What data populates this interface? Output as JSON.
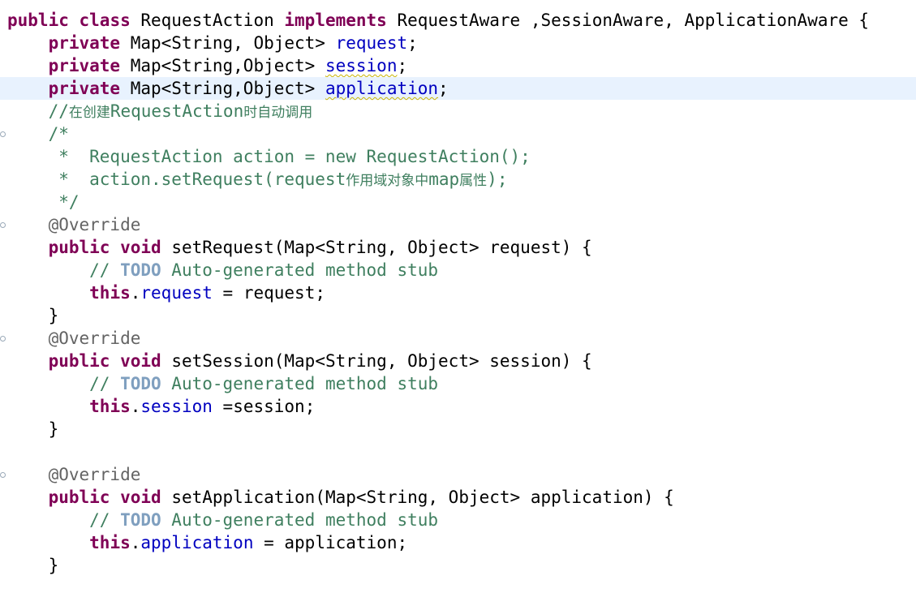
{
  "editor": {
    "lines": [
      {
        "fold": false,
        "current": false,
        "tokens": [
          {
            "t": "public",
            "k": "kw"
          },
          {
            "t": " ",
            "k": "plain"
          },
          {
            "t": "class",
            "k": "kw"
          },
          {
            "t": " RequestAction ",
            "k": "plain"
          },
          {
            "t": "implements",
            "k": "kw"
          },
          {
            "t": " RequestAware ,SessionAware, ApplicationAware {",
            "k": "plain"
          }
        ]
      },
      {
        "fold": false,
        "current": false,
        "tokens": [
          {
            "t": "    ",
            "k": "plain"
          },
          {
            "t": "private",
            "k": "kw"
          },
          {
            "t": " Map<String, Object> ",
            "k": "plain"
          },
          {
            "t": "request",
            "k": "field"
          },
          {
            "t": ";",
            "k": "plain"
          }
        ]
      },
      {
        "fold": false,
        "current": false,
        "tokens": [
          {
            "t": "    ",
            "k": "plain"
          },
          {
            "t": "private",
            "k": "kw"
          },
          {
            "t": " Map<String,Object> ",
            "k": "plain"
          },
          {
            "t": "session",
            "k": "field",
            "squiggle": true
          },
          {
            "t": ";",
            "k": "plain"
          }
        ]
      },
      {
        "fold": false,
        "current": true,
        "tokens": [
          {
            "t": "    ",
            "k": "plain"
          },
          {
            "t": "private",
            "k": "kw"
          },
          {
            "t": " Map<String,Object> ",
            "k": "plain"
          },
          {
            "t": "application",
            "k": "field",
            "squiggle": true
          },
          {
            "t": ";",
            "k": "plain"
          }
        ]
      },
      {
        "fold": false,
        "current": false,
        "tokens": [
          {
            "t": "    //",
            "k": "comment"
          },
          {
            "t": "在创建",
            "k": "comment",
            "cjk": true
          },
          {
            "t": "RequestAction",
            "k": "comment"
          },
          {
            "t": "时自动调用",
            "k": "comment",
            "cjk": true
          }
        ]
      },
      {
        "fold": true,
        "current": false,
        "tokens": [
          {
            "t": "    /*",
            "k": "comment"
          }
        ]
      },
      {
        "fold": false,
        "current": false,
        "tokens": [
          {
            "t": "     *  RequestAction action = new RequestAction();",
            "k": "comment"
          }
        ]
      },
      {
        "fold": false,
        "current": false,
        "tokens": [
          {
            "t": "     *  action.setRequest(request",
            "k": "comment"
          },
          {
            "t": "作用域对象中",
            "k": "comment",
            "cjk": true
          },
          {
            "t": "map",
            "k": "comment"
          },
          {
            "t": "属性",
            "k": "comment",
            "cjk": true
          },
          {
            "t": ");",
            "k": "comment"
          }
        ]
      },
      {
        "fold": false,
        "current": false,
        "tokens": [
          {
            "t": "     */",
            "k": "comment"
          }
        ]
      },
      {
        "fold": true,
        "current": false,
        "tokens": [
          {
            "t": "    ",
            "k": "plain"
          },
          {
            "t": "@Override",
            "k": "ann"
          }
        ]
      },
      {
        "fold": false,
        "current": false,
        "tokens": [
          {
            "t": "    ",
            "k": "plain"
          },
          {
            "t": "public",
            "k": "kw"
          },
          {
            "t": " ",
            "k": "plain"
          },
          {
            "t": "void",
            "k": "kw"
          },
          {
            "t": " setRequest(Map<String, Object> request) {",
            "k": "plain"
          }
        ]
      },
      {
        "fold": false,
        "current": false,
        "tokens": [
          {
            "t": "        // ",
            "k": "comment"
          },
          {
            "t": "TODO",
            "k": "todo"
          },
          {
            "t": " Auto-generated method stub",
            "k": "comment"
          }
        ]
      },
      {
        "fold": false,
        "current": false,
        "tokens": [
          {
            "t": "        ",
            "k": "plain"
          },
          {
            "t": "this",
            "k": "kw"
          },
          {
            "t": ".",
            "k": "plain"
          },
          {
            "t": "request",
            "k": "field"
          },
          {
            "t": " = request;",
            "k": "plain"
          }
        ]
      },
      {
        "fold": false,
        "current": false,
        "tokens": [
          {
            "t": "    }",
            "k": "plain"
          }
        ]
      },
      {
        "fold": true,
        "current": false,
        "tokens": [
          {
            "t": "    ",
            "k": "plain"
          },
          {
            "t": "@Override",
            "k": "ann"
          }
        ]
      },
      {
        "fold": false,
        "current": false,
        "tokens": [
          {
            "t": "    ",
            "k": "plain"
          },
          {
            "t": "public",
            "k": "kw"
          },
          {
            "t": " ",
            "k": "plain"
          },
          {
            "t": "void",
            "k": "kw"
          },
          {
            "t": " setSession(Map<String, Object> session) {",
            "k": "plain"
          }
        ]
      },
      {
        "fold": false,
        "current": false,
        "tokens": [
          {
            "t": "        // ",
            "k": "comment"
          },
          {
            "t": "TODO",
            "k": "todo"
          },
          {
            "t": " Auto-generated method stub",
            "k": "comment"
          }
        ]
      },
      {
        "fold": false,
        "current": false,
        "tokens": [
          {
            "t": "        ",
            "k": "plain"
          },
          {
            "t": "this",
            "k": "kw"
          },
          {
            "t": ".",
            "k": "plain"
          },
          {
            "t": "session",
            "k": "field"
          },
          {
            "t": " =session;",
            "k": "plain"
          }
        ]
      },
      {
        "fold": false,
        "current": false,
        "tokens": [
          {
            "t": "    }",
            "k": "plain"
          }
        ]
      },
      {
        "fold": false,
        "current": false,
        "tokens": []
      },
      {
        "fold": true,
        "current": false,
        "tokens": [
          {
            "t": "    ",
            "k": "plain"
          },
          {
            "t": "@Override",
            "k": "ann"
          }
        ]
      },
      {
        "fold": false,
        "current": false,
        "tokens": [
          {
            "t": "    ",
            "k": "plain"
          },
          {
            "t": "public",
            "k": "kw"
          },
          {
            "t": " ",
            "k": "plain"
          },
          {
            "t": "void",
            "k": "kw"
          },
          {
            "t": " setApplication(Map<String, Object> application) {",
            "k": "plain"
          }
        ]
      },
      {
        "fold": false,
        "current": false,
        "tokens": [
          {
            "t": "        // ",
            "k": "comment"
          },
          {
            "t": "TODO",
            "k": "todo"
          },
          {
            "t": " Auto-generated method stub",
            "k": "comment"
          }
        ]
      },
      {
        "fold": false,
        "current": false,
        "tokens": [
          {
            "t": "        ",
            "k": "plain"
          },
          {
            "t": "this",
            "k": "kw"
          },
          {
            "t": ".",
            "k": "plain"
          },
          {
            "t": "application",
            "k": "field"
          },
          {
            "t": " = application;",
            "k": "plain"
          }
        ]
      },
      {
        "fold": false,
        "current": false,
        "tokens": [
          {
            "t": "    }",
            "k": "plain"
          }
        ]
      }
    ]
  },
  "colors": {
    "keyword": "#7f0055",
    "field": "#0000c0",
    "comment": "#3f7f5f",
    "todo": "#7f9fbf",
    "annotation": "#646464",
    "current_line": "#e8f2fe"
  }
}
